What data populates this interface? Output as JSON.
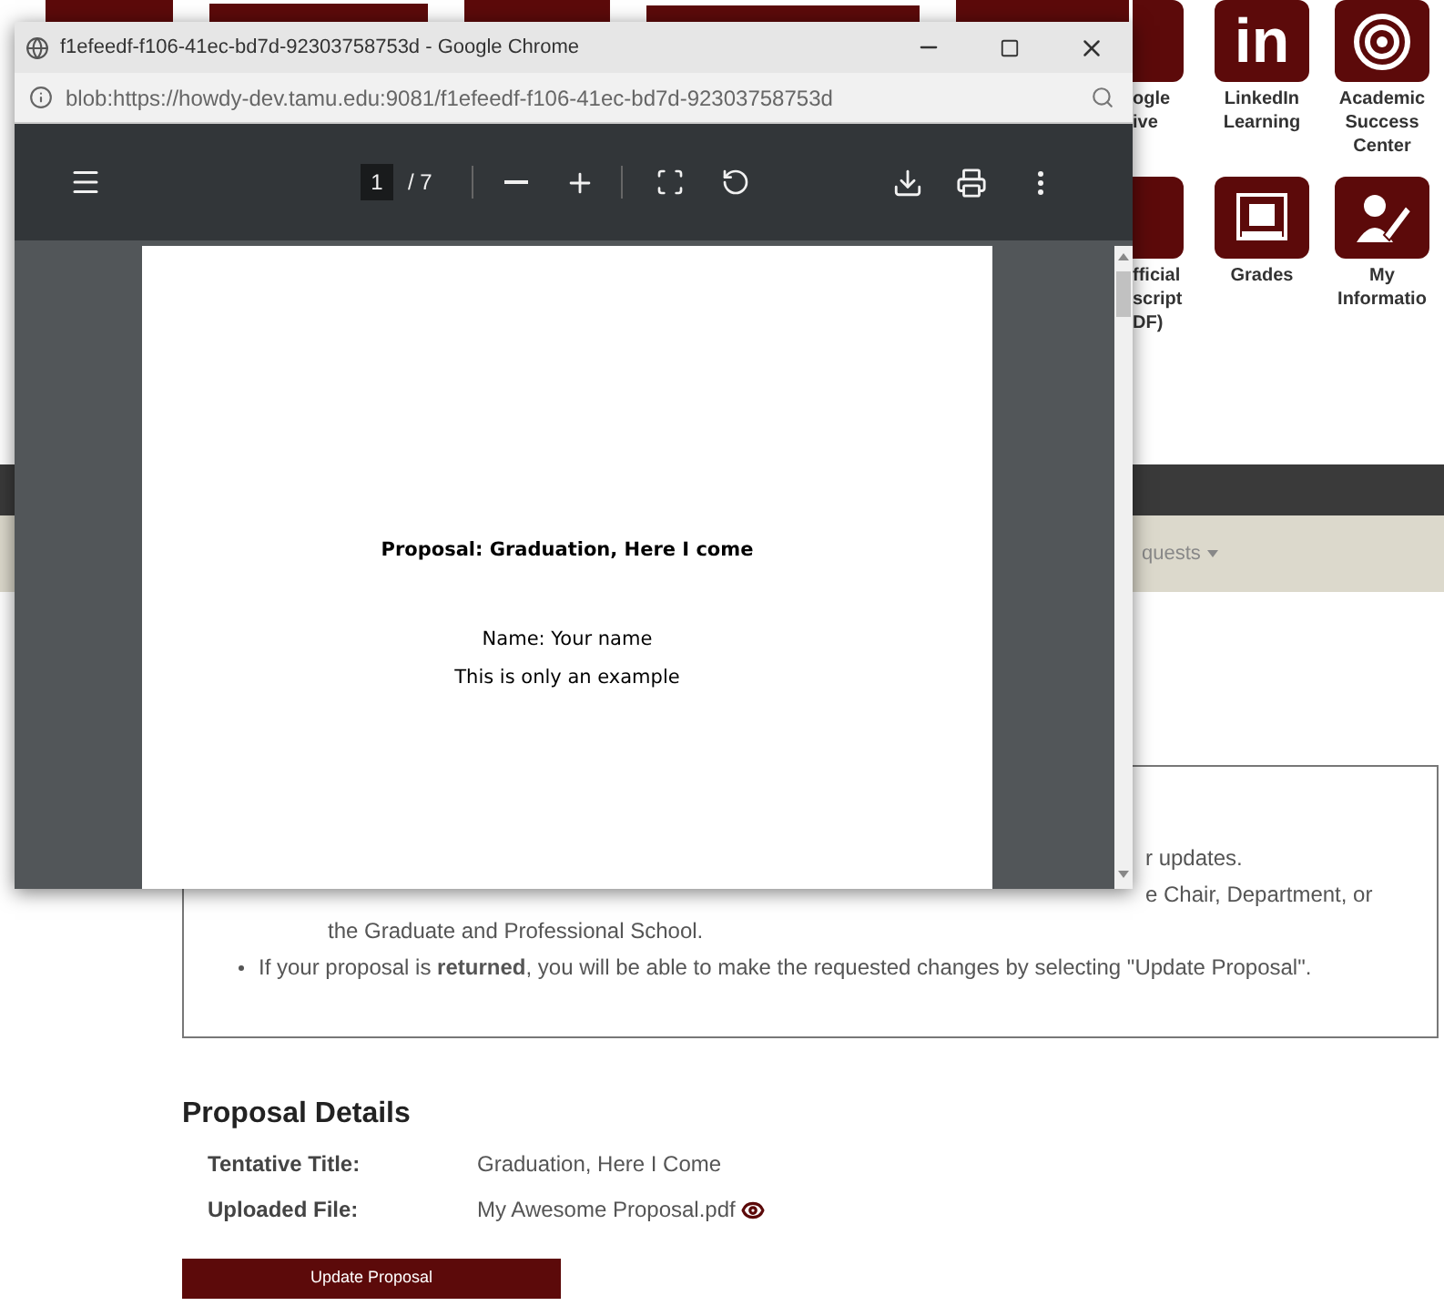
{
  "browser_window": {
    "title": "f1efeedf-f106-41ec-bd7d-92303758753d - Google Chrome",
    "address": "blob:https://howdy-dev.tamu.edu:9081/f1efeedf-f106-41ec-bd7d-92303758753d",
    "pdf_toolbar": {
      "page": "1",
      "page_count": "/ 7"
    },
    "document": {
      "lines": [
        {
          "text": "Proposal: Graduation, Here I come",
          "kind": "heading"
        },
        {
          "text": "Name: Your name",
          "kind": "body"
        },
        {
          "text": "This is only an example",
          "kind": "body"
        }
      ]
    }
  },
  "app_tiles": [
    {
      "kind": "drive-partial",
      "label_lines": [
        "ogle",
        "ive"
      ]
    },
    {
      "kind": "linkedin",
      "logo_text": "in",
      "label_lines": [
        "LinkedIn",
        "Learning"
      ]
    },
    {
      "kind": "target",
      "label_lines": [
        "Academic",
        "Success",
        "Center"
      ]
    },
    {
      "kind": "transcript-partial",
      "label_lines": [
        "fficial",
        "script",
        "DF)"
      ]
    },
    {
      "kind": "grades",
      "label_lines": [
        "Grades"
      ]
    },
    {
      "kind": "person-edit",
      "label_lines": [
        "My",
        "Informatio"
      ]
    }
  ],
  "nav": {
    "menu_fragment": "quests"
  },
  "notice": {
    "fragments": [
      "r updates.",
      "e Chair, Department, or"
    ],
    "continuation": "the Graduate and Professional School.",
    "bullets": [
      "If your proposal is **returned**, you will be able to make the requested changes by selecting \"Update Proposal\"."
    ]
  },
  "proposal_details": {
    "heading": "Proposal Details",
    "rows": [
      {
        "label": "Tentative Title:",
        "value": "Graduation, Here I Come",
        "kind": "text"
      },
      {
        "label": "Uploaded File:",
        "value": "My Awesome Proposal.pdf",
        "kind": "file"
      }
    ],
    "button": "Update Proposal"
  }
}
